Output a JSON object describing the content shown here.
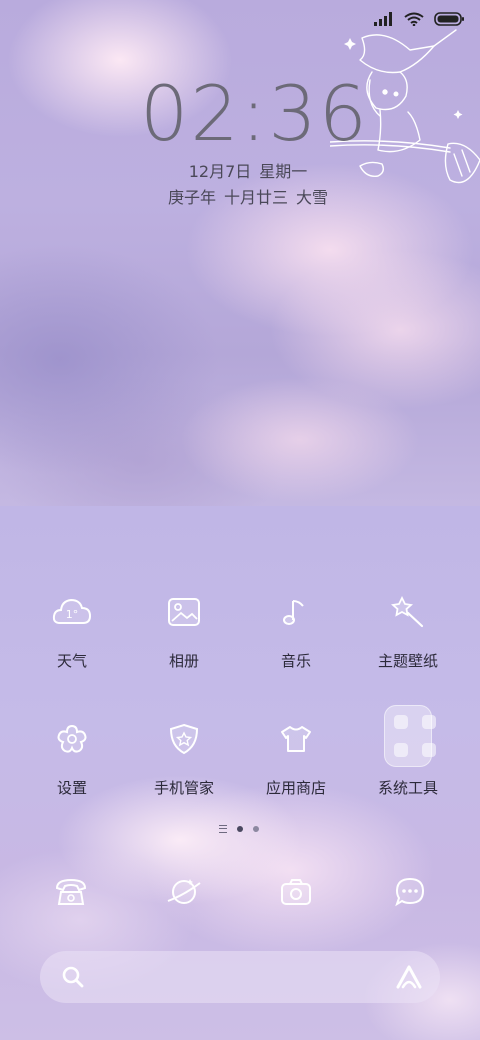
{
  "status_bar": {
    "icons": [
      "signal-icon",
      "wifi-icon",
      "battery-icon"
    ]
  },
  "clock": {
    "time": "02:36",
    "date": "12月7日",
    "weekday": "星期一",
    "lunar_year": "庚子年",
    "lunar_date": "十月廿三",
    "solar_term": "大雪"
  },
  "apps": [
    {
      "label": "天气",
      "icon": "weather-icon"
    },
    {
      "label": "相册",
      "icon": "gallery-icon"
    },
    {
      "label": "音乐",
      "icon": "music-icon"
    },
    {
      "label": "主题壁纸",
      "icon": "theme-wand-icon"
    },
    {
      "label": "设置",
      "icon": "settings-flower-icon"
    },
    {
      "label": "手机管家",
      "icon": "security-shield-icon"
    },
    {
      "label": "应用商店",
      "icon": "app-store-shirt-icon"
    },
    {
      "label": "系统工具",
      "icon": "folder-icon"
    }
  ],
  "weather_icon_text": "1°",
  "page_indicator": {
    "pages": 2,
    "active": 1
  },
  "dock": [
    {
      "icon": "phone-icon"
    },
    {
      "icon": "browser-planet-icon"
    },
    {
      "icon": "camera-icon"
    },
    {
      "icon": "messages-icon"
    }
  ],
  "search_bar": {
    "left_icon": "search-icon",
    "right_icon": "assistant-a-icon"
  },
  "colors": {
    "lavender": "#c2b7e3",
    "clock_gray": "#6c6a78",
    "label_dark": "#2c2a3a",
    "icon_white": "#ffffff"
  }
}
